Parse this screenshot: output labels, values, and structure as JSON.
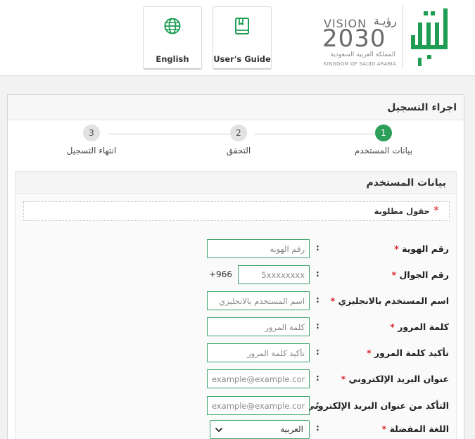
{
  "header": {
    "language_label": "English",
    "guide_label": "User's Guide",
    "vision": {
      "word": "VISION",
      "word_ar": "رؤيـة",
      "year": "2030",
      "kingdom_ar": "المملكة العربية السعودية",
      "kingdom_en": "KINGDOM OF SAUDI ARABIA"
    },
    "logo_text": "أبشر"
  },
  "panel": {
    "title": "اجراء التسجيل"
  },
  "steps": [
    {
      "number": "1",
      "label": "بيانات المستخدم",
      "active": true
    },
    {
      "number": "2",
      "label": "التحقق",
      "active": false
    },
    {
      "number": "3",
      "label": "انتهاء التسجيل",
      "active": false
    }
  ],
  "form": {
    "title": "بيانات المستخدم",
    "required_note": "حقول مطلوبة",
    "required_mark": "*",
    "colon": ":",
    "fields": {
      "id_number": {
        "label": "رقم الهوية",
        "placeholder": "رقم الهوية"
      },
      "mobile": {
        "label": "رقم الجوال",
        "placeholder": "5xxxxxxxx",
        "prefix": "+966"
      },
      "username": {
        "label": "اسم المستخدم بالانجليزي",
        "placeholder": "اسم المستخدم بالانجليزي"
      },
      "password": {
        "label": "كلمة المرور",
        "placeholder": "كلمة المرور"
      },
      "confirm_password": {
        "label": "تأكيد كلمة المرور",
        "placeholder": "تأكيد كلمة المرور"
      },
      "email": {
        "label": "عنوان البريد الإلكتروني",
        "placeholder": "example@example.com"
      },
      "confirm_email": {
        "label": "التأكد من عنوان البريد الإلكتروني",
        "placeholder": "example@example.com"
      },
      "language": {
        "label": "اللغة المفضلة",
        "value": "العربية"
      }
    }
  },
  "colors": {
    "accent_green": "#2e9e5b",
    "input_border": "#3aa36a",
    "required_red": "#d7262d"
  }
}
